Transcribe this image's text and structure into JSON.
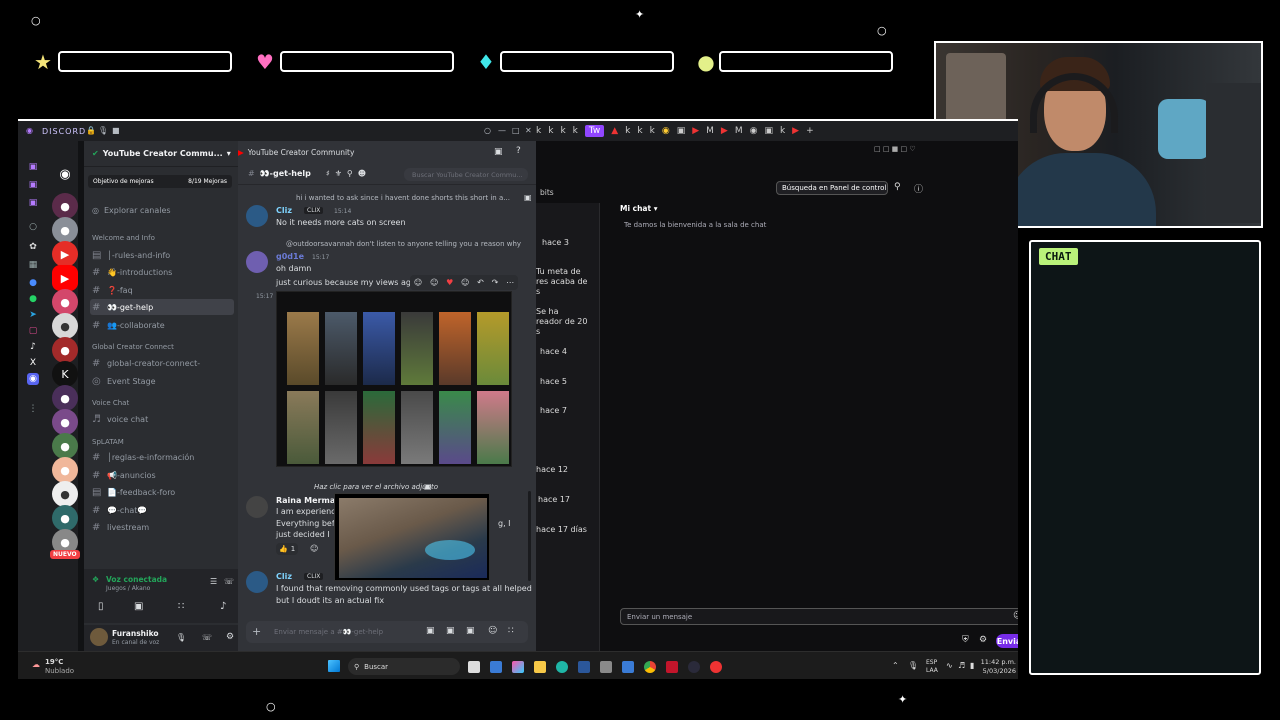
{
  "overlay": {
    "chat_label": "CHAT"
  },
  "discord": {
    "window_title": "DISCORD",
    "server_name": "YouTube Creator Commu...",
    "boost_label": "Objetivo de mejoras",
    "boost_count": "8/19 Mejoras",
    "explore": "Explorar canales",
    "channels": [
      {
        "type": "cat",
        "label": "Welcome and Info"
      },
      {
        "type": "ch",
        "label": "│-rules-and-info"
      },
      {
        "type": "ch",
        "label": "👋-introductions"
      },
      {
        "type": "ch",
        "label": "❓-faq"
      },
      {
        "type": "ch",
        "label": "👀-get-help",
        "active": true
      },
      {
        "type": "ch",
        "label": "👥-collaborate"
      },
      {
        "type": "cat",
        "label": "Global Creator Connect"
      },
      {
        "type": "ch",
        "label": "global-creator-connect-"
      },
      {
        "type": "ch",
        "label": "Event Stage"
      },
      {
        "type": "cat",
        "label": "Voice Chat"
      },
      {
        "type": "ch",
        "label": "voice chat"
      },
      {
        "type": "cat",
        "label": "SpLATAM"
      },
      {
        "type": "ch",
        "label": "│reglas-e-información"
      },
      {
        "type": "ch",
        "label": "📢-anuncios"
      },
      {
        "type": "ch",
        "label": "📄-feedback-foro"
      },
      {
        "type": "ch",
        "label": "💬-chat💬"
      },
      {
        "type": "ch",
        "label": "livestream"
      }
    ],
    "voice_status": "Voz conectada",
    "voice_sub": "Juegos / Akano",
    "user_name": "Furanshiko",
    "user_status": "En canal de voz",
    "server_banner": "YouTube Creator Community",
    "channel_header": "👀-get-help",
    "search_placeholder": "Buscar YouTube Creator Commu...",
    "messages": {
      "reply1": "hi i wanted to ask since i havent done shorts this short in a...",
      "author1": "Cliz",
      "tag1": "CLIX",
      "time1": "15:14",
      "text1": "No it needs more cats on screen",
      "reply2": "@outdoorsavannah don't listen to anyone telling you a reason why",
      "author2": "g0d1e",
      "time2": "15:17",
      "text2a": "oh damn",
      "text2b": "just curious because my views again h",
      "img_time": "15:17",
      "reply3": "Haz clic para ver el archivo adjunto",
      "author3": "Raina Mermai",
      "text3a": "I am experienc",
      "text3b": "Everything bef",
      "text3c": "just decided I",
      "text3d": "g, I",
      "reaction_count": "1",
      "author4": "Cliz",
      "tag4": "CLIX",
      "text4a": "I found that removing commonly used tags or tags at all helped",
      "text4b": "but I doudt its an actual fix"
    },
    "composer_placeholder": "Enviar mensaje a #👀-get-help",
    "new_badge": "NUEVO"
  },
  "twitch": {
    "bits_label": "bits",
    "search_button": "Búsqueda en Panel de control",
    "chat_header": "Mi chat",
    "welcome": "Te damos la bienvenida a la sala de chat",
    "activity": [
      "hace 3",
      "Tu meta de",
      "res acaba de",
      "s",
      "Se ha",
      "reador de 20",
      "s",
      "hace 4",
      "hace 5",
      "hace 7",
      "hace 12",
      "hace 17",
      "hace 17 días"
    ],
    "chat_placeholder": "Enviar un mensaje",
    "send_button": "Enviar"
  },
  "taskbar": {
    "temp": "19°C",
    "weather": "Nublado",
    "search": "Buscar",
    "lang1": "ESP",
    "lang2": "LAA",
    "time": "11:42 p.m.",
    "date": "5/03/2026"
  }
}
